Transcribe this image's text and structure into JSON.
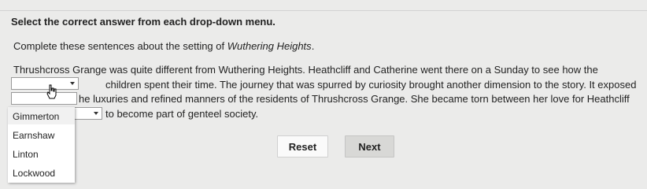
{
  "instruction": "Select the correct answer from each drop-down menu.",
  "subinstruction_prefix": "Complete these sentences about the setting of ",
  "subinstruction_title": "Wuthering Heights",
  "subinstruction_suffix": ".",
  "paragraph": {
    "line1": "Thrushcross Grange was quite different from Wuthering Heights. Heathcliff and Catherine went there on a Sunday to see how the",
    "line2": "children spent their time. The journey that was spurred by curiosity brought another dimension to the story. It exposed",
    "line3": "he luxuries and refined manners of the residents of Thrushcross Grange. She became torn between her love for Heathcliff",
    "line4": "to become part of genteel society."
  },
  "dropdown_options": [
    "Gimmerton",
    "Earnshaw",
    "Linton",
    "Lockwood"
  ],
  "buttons": {
    "reset": "Reset",
    "next": "Next"
  }
}
